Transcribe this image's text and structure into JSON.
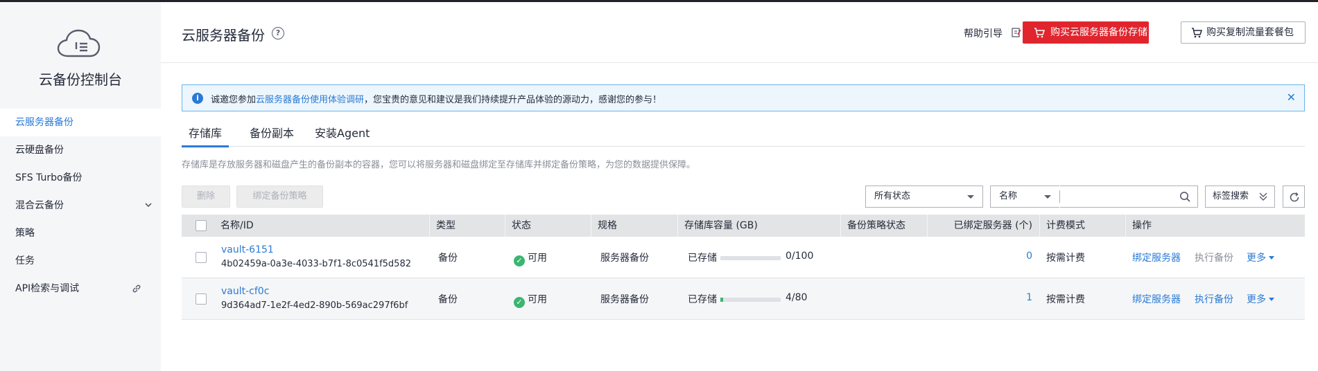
{
  "sidebar": {
    "console_title": "云备份控制台",
    "items": [
      {
        "label": "云服务器备份",
        "active": true
      },
      {
        "label": "云硬盘备份"
      },
      {
        "label": "SFS Turbo备份"
      },
      {
        "label": "混合云备份"
      },
      {
        "label": "策略"
      },
      {
        "label": "任务"
      },
      {
        "label": "API检索与调试"
      }
    ]
  },
  "header": {
    "title": "云服务器备份",
    "help_guide": "帮助引导",
    "buy_vault_button": "购买云服务器备份存储库",
    "buy_traffic_button": "购买复制流量套餐包"
  },
  "notice": {
    "prefix": "诚邀您参加",
    "link": "云服务器备份使用体验调研",
    "suffix": "，您宝贵的意见和建议是我们持续提升产品体验的源动力，感谢您的参与！"
  },
  "tabs": [
    "存储库",
    "备份副本",
    "安装Agent"
  ],
  "description": "存储库是存放服务器和磁盘产生的备份副本的容器，您可以将服务器和磁盘绑定至存储库并绑定备份策略，为您的数据提供保障。",
  "toolbar": {
    "delete": "删除",
    "bind_policy": "绑定备份策略",
    "status_filter": "所有状态",
    "search_field": "名称",
    "search_placeholder": "",
    "tag_search": "标签搜索"
  },
  "table": {
    "columns": [
      "名称/ID",
      "类型",
      "状态",
      "规格",
      "存储库容量 (GB)",
      "备份策略状态",
      "已绑定服务器 (个)",
      "计费模式",
      "操作"
    ],
    "rows": [
      {
        "name": "vault-6151",
        "id": "4b02459a-0a3e-4033-b7f1-8c0541f5d582",
        "type": "备份",
        "status": "可用",
        "spec": "服务器备份",
        "stored_label": "已存储",
        "capacity_text": "0/100",
        "used_fraction": 0.0,
        "policy_status": "",
        "bound_servers": "0",
        "billing": "按需计费",
        "action_bind": "绑定服务器",
        "action_backup": "执行备份",
        "action_backup_enabled": false,
        "action_more": "更多"
      },
      {
        "name": "vault-cf0c",
        "id": "9d364ad7-1e2f-4ed2-890b-569ac297f6bf",
        "type": "备份",
        "status": "可用",
        "spec": "服务器备份",
        "stored_label": "已存储",
        "capacity_text": "4/80",
        "used_fraction": 0.05,
        "policy_status": "",
        "bound_servers": "1",
        "billing": "按需计费",
        "action_bind": "绑定服务器",
        "action_backup": "执行备份",
        "action_backup_enabled": true,
        "action_more": "更多"
      }
    ]
  },
  "colors": {
    "accent": "#2a7ad6",
    "buy_button": "#e0252e",
    "status_ok": "#3ab672"
  }
}
